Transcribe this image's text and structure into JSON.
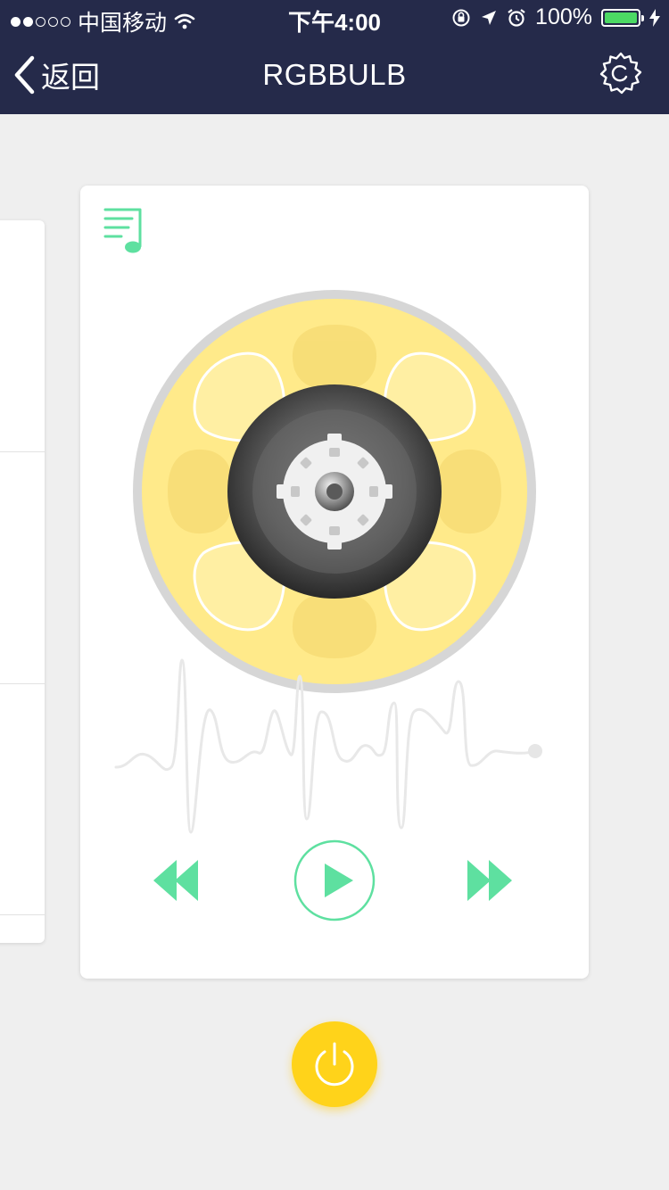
{
  "status_bar": {
    "carrier": "中国移动",
    "time": "下午4:00",
    "battery": "100%"
  },
  "nav": {
    "back_label": "返回",
    "title": "RGBBULB"
  },
  "colors": {
    "header_bg": "#252a4a",
    "accent_green": "#5ee0a0",
    "disc_yellow": "#ffea8a",
    "power_yellow": "#ffd31a"
  },
  "icons": {
    "back": "chevron-left-icon",
    "settings": "gear-icon",
    "playlist": "music-playlist-icon",
    "rewind": "rewind-icon",
    "play": "play-icon",
    "forward": "fast-forward-icon",
    "power": "power-icon"
  }
}
